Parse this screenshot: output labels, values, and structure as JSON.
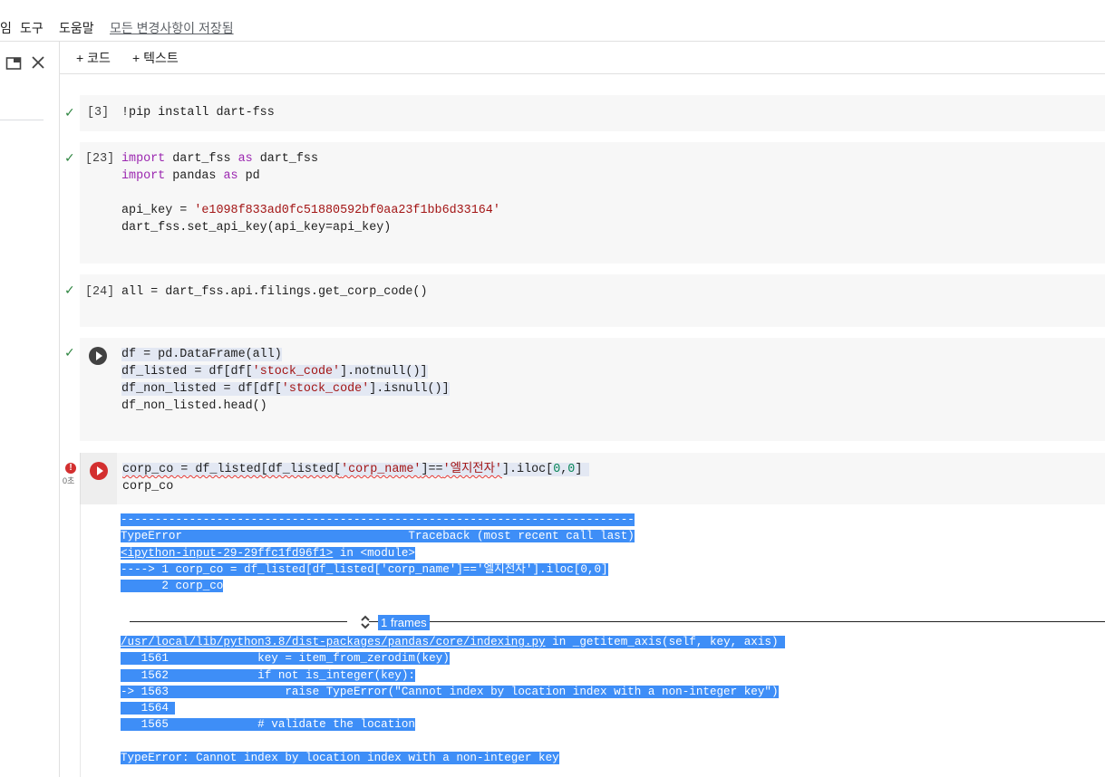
{
  "menu": {
    "items": [
      "임",
      "도구",
      "도움말"
    ],
    "saved_status": "모든 변경사항이 저장됨"
  },
  "toolbar": {
    "add_code": "+ 코드",
    "add_text": "+ 텍스트"
  },
  "cells": [
    {
      "exec_count": "[3]",
      "status": "✓",
      "code": "!pip install dart-fss"
    },
    {
      "exec_count": "[23]",
      "status": "✓",
      "lines": [
        [
          "import",
          " dart_fss ",
          "as",
          " dart_fss"
        ],
        [
          "import",
          " pandas ",
          "as",
          " pd"
        ],
        "api_key = ",
        "'e1098f833ad0fc51880592bf0aa23f1bb6d33164'",
        "dart_fss.set_api_key(api_key=api_key)"
      ]
    },
    {
      "exec_count": "[24]",
      "status": "✓",
      "code": "all = dart_fss.api.filings.get_corp_code()"
    },
    {
      "status": "✓",
      "lines": [
        "df = pd.DataFrame(all)",
        "df_listed = df[df[",
        "'stock_code'",
        "].notnull()]",
        "df_non_listed = df[df[",
        "'stock_code'",
        "].isnull()]",
        "df_non_listed.head()"
      ]
    },
    {
      "status": "!",
      "time": "0초",
      "lines": [
        "corp_co = df_listed[df_listed[",
        "'corp_name'",
        "]==",
        "'엘지전자'",
        "].iloc[",
        "0",
        ",",
        "0",
        "]",
        "corp_co"
      ]
    }
  ],
  "traceback": {
    "divider": "---------------------------------------------------------------------------",
    "error_type_line": "TypeError                                 Traceback (most recent call last)",
    "input_link": "<ipython-input-29-29ffc1fd96f1>",
    "input_suffix": " in <module>",
    "line_arrow": "----> 1 corp_co = df_listed[df_listed['corp_name']=='엘지전자'].iloc[0,0]",
    "line_2": "      2 corp_co",
    "frames_label": "1 frames",
    "file_link": "/usr/local/lib/python3.8/dist-packages/pandas/core/indexing.py",
    "file_suffix": " in _getitem_axis(self, key, axis)",
    "src_lines": [
      "   1561             key = item_from_zerodim(key)",
      "   1562             if not is_integer(key):",
      "-> 1563                 raise TypeError(\"Cannot index by location index with a non-integer key\")",
      "   1564 ",
      "   1565             # validate the location"
    ],
    "final_error": "TypeError: Cannot index by location index with a non-integer key"
  }
}
